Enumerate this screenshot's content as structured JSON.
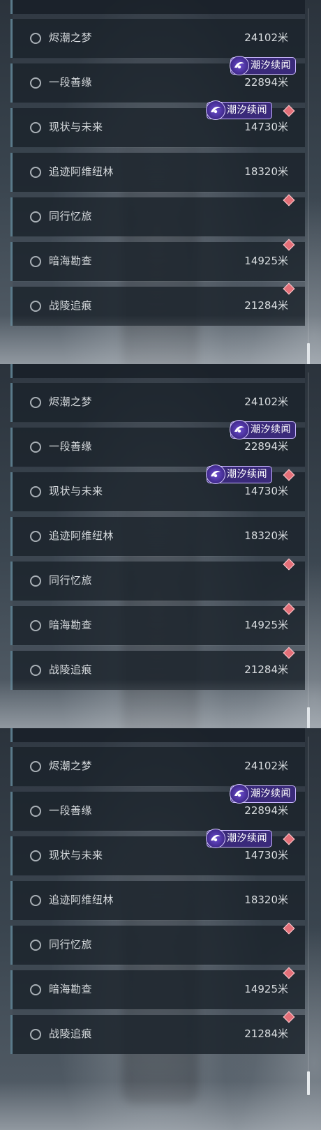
{
  "badge_label": "潮汐续闻",
  "panels": [
    {
      "rows": [
        {
          "name": "烬潮之梦",
          "distance": "24102米"
        },
        {
          "name": "一段善缘",
          "distance": "22894米"
        },
        {
          "name": "现状与未来",
          "distance": "14730米"
        },
        {
          "name": "追迹阿维纽林",
          "distance": "18320米"
        },
        {
          "name": "同行忆旅",
          "distance": ""
        },
        {
          "name": "暗海勘查",
          "distance": "14925米"
        },
        {
          "name": "战陵追痕",
          "distance": "21284米"
        }
      ]
    },
    {
      "rows": [
        {
          "name": "烬潮之梦",
          "distance": "24102米"
        },
        {
          "name": "一段善缘",
          "distance": "22894米"
        },
        {
          "name": "现状与未来",
          "distance": "14730米"
        },
        {
          "name": "追迹阿维纽林",
          "distance": "18320米"
        },
        {
          "name": "同行忆旅",
          "distance": ""
        },
        {
          "name": "暗海勘查",
          "distance": "14925米"
        },
        {
          "name": "战陵追痕",
          "distance": "21284米"
        }
      ]
    },
    {
      "rows": [
        {
          "name": "烬潮之梦",
          "distance": "24102米"
        },
        {
          "name": "一段善缘",
          "distance": "22894米"
        },
        {
          "name": "现状与未来",
          "distance": "14730米"
        },
        {
          "name": "追迹阿维纽林",
          "distance": "18320米"
        },
        {
          "name": "同行忆旅",
          "distance": ""
        },
        {
          "name": "暗海勘查",
          "distance": "14925米"
        },
        {
          "name": "战陵追痕",
          "distance": "21284米"
        }
      ]
    }
  ],
  "colors": {
    "badge_bg": "#3a2a7a",
    "gem": "#e46f78",
    "accent_bar": "#5a7a8a"
  },
  "icons": {
    "badge_icon": "tide-emblem-icon",
    "marker": "red-diamond-icon",
    "radio": "empty-radio-icon"
  }
}
